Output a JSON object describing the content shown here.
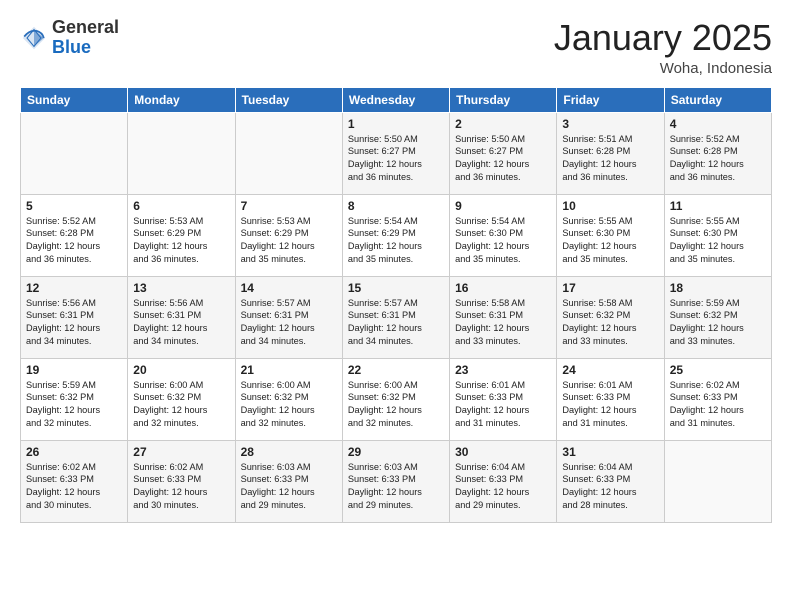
{
  "header": {
    "logo_general": "General",
    "logo_blue": "Blue",
    "title": "January 2025",
    "subtitle": "Woha, Indonesia"
  },
  "weekdays": [
    "Sunday",
    "Monday",
    "Tuesday",
    "Wednesday",
    "Thursday",
    "Friday",
    "Saturday"
  ],
  "weeks": [
    [
      {
        "day": "",
        "info": ""
      },
      {
        "day": "",
        "info": ""
      },
      {
        "day": "",
        "info": ""
      },
      {
        "day": "1",
        "info": "Sunrise: 5:50 AM\nSunset: 6:27 PM\nDaylight: 12 hours\nand 36 minutes."
      },
      {
        "day": "2",
        "info": "Sunrise: 5:50 AM\nSunset: 6:27 PM\nDaylight: 12 hours\nand 36 minutes."
      },
      {
        "day": "3",
        "info": "Sunrise: 5:51 AM\nSunset: 6:28 PM\nDaylight: 12 hours\nand 36 minutes."
      },
      {
        "day": "4",
        "info": "Sunrise: 5:52 AM\nSunset: 6:28 PM\nDaylight: 12 hours\nand 36 minutes."
      }
    ],
    [
      {
        "day": "5",
        "info": "Sunrise: 5:52 AM\nSunset: 6:28 PM\nDaylight: 12 hours\nand 36 minutes."
      },
      {
        "day": "6",
        "info": "Sunrise: 5:53 AM\nSunset: 6:29 PM\nDaylight: 12 hours\nand 36 minutes."
      },
      {
        "day": "7",
        "info": "Sunrise: 5:53 AM\nSunset: 6:29 PM\nDaylight: 12 hours\nand 35 minutes."
      },
      {
        "day": "8",
        "info": "Sunrise: 5:54 AM\nSunset: 6:29 PM\nDaylight: 12 hours\nand 35 minutes."
      },
      {
        "day": "9",
        "info": "Sunrise: 5:54 AM\nSunset: 6:30 PM\nDaylight: 12 hours\nand 35 minutes."
      },
      {
        "day": "10",
        "info": "Sunrise: 5:55 AM\nSunset: 6:30 PM\nDaylight: 12 hours\nand 35 minutes."
      },
      {
        "day": "11",
        "info": "Sunrise: 5:55 AM\nSunset: 6:30 PM\nDaylight: 12 hours\nand 35 minutes."
      }
    ],
    [
      {
        "day": "12",
        "info": "Sunrise: 5:56 AM\nSunset: 6:31 PM\nDaylight: 12 hours\nand 34 minutes."
      },
      {
        "day": "13",
        "info": "Sunrise: 5:56 AM\nSunset: 6:31 PM\nDaylight: 12 hours\nand 34 minutes."
      },
      {
        "day": "14",
        "info": "Sunrise: 5:57 AM\nSunset: 6:31 PM\nDaylight: 12 hours\nand 34 minutes."
      },
      {
        "day": "15",
        "info": "Sunrise: 5:57 AM\nSunset: 6:31 PM\nDaylight: 12 hours\nand 34 minutes."
      },
      {
        "day": "16",
        "info": "Sunrise: 5:58 AM\nSunset: 6:31 PM\nDaylight: 12 hours\nand 33 minutes."
      },
      {
        "day": "17",
        "info": "Sunrise: 5:58 AM\nSunset: 6:32 PM\nDaylight: 12 hours\nand 33 minutes."
      },
      {
        "day": "18",
        "info": "Sunrise: 5:59 AM\nSunset: 6:32 PM\nDaylight: 12 hours\nand 33 minutes."
      }
    ],
    [
      {
        "day": "19",
        "info": "Sunrise: 5:59 AM\nSunset: 6:32 PM\nDaylight: 12 hours\nand 32 minutes."
      },
      {
        "day": "20",
        "info": "Sunrise: 6:00 AM\nSunset: 6:32 PM\nDaylight: 12 hours\nand 32 minutes."
      },
      {
        "day": "21",
        "info": "Sunrise: 6:00 AM\nSunset: 6:32 PM\nDaylight: 12 hours\nand 32 minutes."
      },
      {
        "day": "22",
        "info": "Sunrise: 6:00 AM\nSunset: 6:32 PM\nDaylight: 12 hours\nand 32 minutes."
      },
      {
        "day": "23",
        "info": "Sunrise: 6:01 AM\nSunset: 6:33 PM\nDaylight: 12 hours\nand 31 minutes."
      },
      {
        "day": "24",
        "info": "Sunrise: 6:01 AM\nSunset: 6:33 PM\nDaylight: 12 hours\nand 31 minutes."
      },
      {
        "day": "25",
        "info": "Sunrise: 6:02 AM\nSunset: 6:33 PM\nDaylight: 12 hours\nand 31 minutes."
      }
    ],
    [
      {
        "day": "26",
        "info": "Sunrise: 6:02 AM\nSunset: 6:33 PM\nDaylight: 12 hours\nand 30 minutes."
      },
      {
        "day": "27",
        "info": "Sunrise: 6:02 AM\nSunset: 6:33 PM\nDaylight: 12 hours\nand 30 minutes."
      },
      {
        "day": "28",
        "info": "Sunrise: 6:03 AM\nSunset: 6:33 PM\nDaylight: 12 hours\nand 29 minutes."
      },
      {
        "day": "29",
        "info": "Sunrise: 6:03 AM\nSunset: 6:33 PM\nDaylight: 12 hours\nand 29 minutes."
      },
      {
        "day": "30",
        "info": "Sunrise: 6:04 AM\nSunset: 6:33 PM\nDaylight: 12 hours\nand 29 minutes."
      },
      {
        "day": "31",
        "info": "Sunrise: 6:04 AM\nSunset: 6:33 PM\nDaylight: 12 hours\nand 28 minutes."
      },
      {
        "day": "",
        "info": ""
      }
    ]
  ]
}
